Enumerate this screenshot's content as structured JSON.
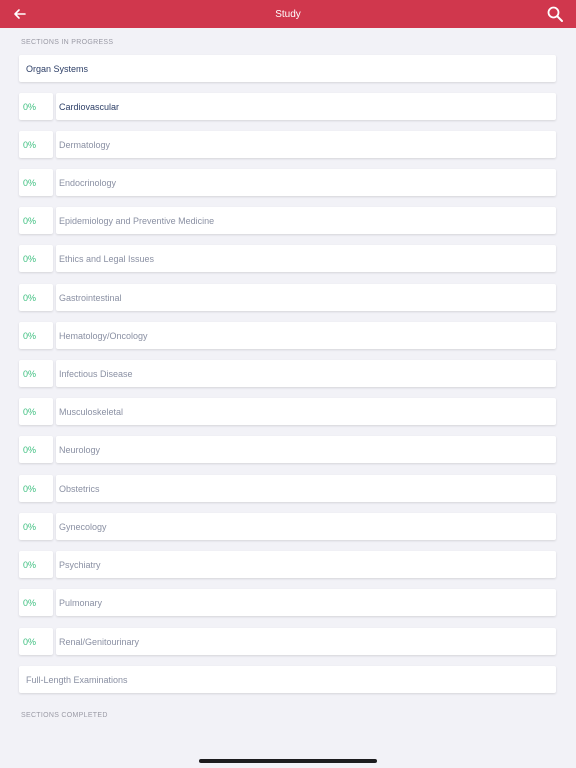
{
  "header": {
    "title": "Study",
    "back_icon": "arrow-left-icon",
    "search_icon": "search-icon",
    "bar_color": "#d0374d"
  },
  "sections_in_progress": {
    "label": "SECTIONS IN PROGRESS",
    "group_title": "Organ Systems",
    "items": [
      {
        "percent": "0%",
        "label": "Cardiovascular"
      },
      {
        "percent": "0%",
        "label": "Dermatology"
      },
      {
        "percent": "0%",
        "label": "Endocrinology"
      },
      {
        "percent": "0%",
        "label": "Epidemiology and Preventive Medicine"
      },
      {
        "percent": "0%",
        "label": "Ethics and Legal Issues"
      },
      {
        "percent": "0%",
        "label": "Gastrointestinal"
      },
      {
        "percent": "0%",
        "label": "Hematology/Oncology"
      },
      {
        "percent": "0%",
        "label": "Infectious Disease"
      },
      {
        "percent": "0%",
        "label": "Musculoskeletal"
      },
      {
        "percent": "0%",
        "label": "Neurology"
      },
      {
        "percent": "0%",
        "label": "Obstetrics"
      },
      {
        "percent": "0%",
        "label": "Gynecology"
      },
      {
        "percent": "0%",
        "label": "Psychiatry"
      },
      {
        "percent": "0%",
        "label": "Pulmonary"
      },
      {
        "percent": "0%",
        "label": "Renal/Genitourinary"
      }
    ],
    "full_length_label": "Full-Length Examinations"
  },
  "sections_completed": {
    "label": "SECTIONS COMPLETED"
  },
  "colors": {
    "percent": "#3cbf7f",
    "active_text": "#2c3e66",
    "inactive_text": "#8a90a3"
  }
}
